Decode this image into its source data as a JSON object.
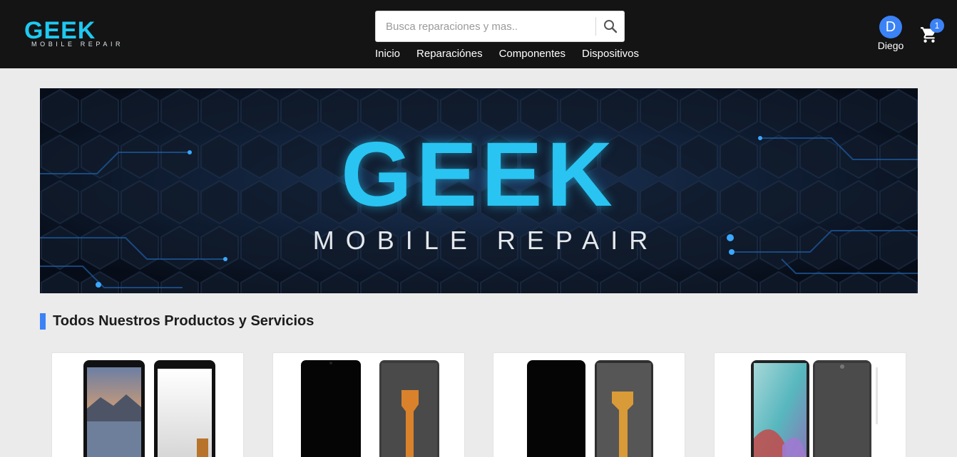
{
  "header": {
    "logo_main": "GEEK",
    "logo_sub": "MOBILE REPAIR",
    "search": {
      "placeholder": "Busca reparaciones y mas.."
    },
    "nav": [
      "Inicio",
      "Reparaciónes",
      "Componentes",
      "Dispositivos"
    ],
    "user": {
      "initial": "D",
      "name": "Diego"
    },
    "cart": {
      "count": "1"
    }
  },
  "banner": {
    "title": "GEEK",
    "subtitle": "MOBILE REPAIR"
  },
  "section": {
    "title": "Todos Nuestros Productos y Servicios"
  },
  "products": [
    {
      "icon": "phone-screen-mountain-icon"
    },
    {
      "icon": "phone-screen-black-icon"
    },
    {
      "icon": "phone-screen-black-icon"
    },
    {
      "icon": "phone-screen-wallpaper-icon"
    }
  ],
  "colors": {
    "accent": "#3b82f6",
    "header_bg": "#141414",
    "brand_cyan": "#29c4f2",
    "page_bg": "#ebebeb"
  }
}
